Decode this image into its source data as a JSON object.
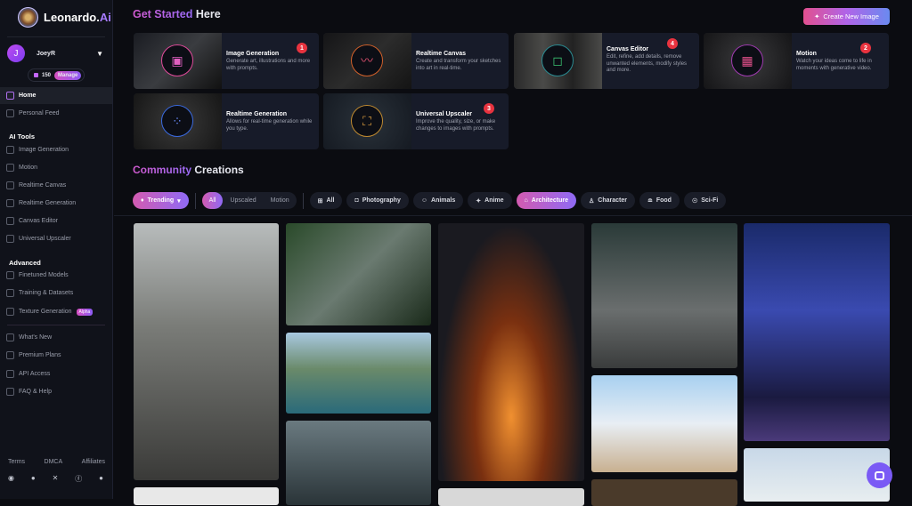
{
  "sidebar": {
    "logo": "Leonardo.",
    "logo_ai": "Ai",
    "user": "JoeyR",
    "avatar_initial": "J",
    "tokens": "150",
    "manage": "Manage",
    "home": "Home",
    "personal_feed": "Personal Feed",
    "ai_tools": "AI Tools",
    "tools": [
      "Image Generation",
      "Motion",
      "Realtime Canvas",
      "Realtime Generation",
      "Canvas Editor",
      "Universal Upscaler"
    ],
    "advanced": "Advanced",
    "advanced_items": [
      "Finetuned Models",
      "Training & Datasets",
      "Texture Generation"
    ],
    "alpha": "Alpha",
    "misc": [
      "What's New",
      "Premium Plans",
      "API Access",
      "FAQ & Help"
    ],
    "footer": [
      "Terms",
      "DMCA",
      "Affiliates"
    ],
    "social": [
      "discord-icon",
      "reddit-icon",
      "x-icon",
      "facebook-icon",
      "apple-icon"
    ]
  },
  "header": {
    "title_a": "Get Started",
    "title_b": "Here",
    "create": "Create New Image"
  },
  "cards": [
    {
      "title": "Image Generation",
      "desc": "Generate art, illustrations and more with prompts.",
      "badge": "1"
    },
    {
      "title": "Realtime Canvas",
      "desc": "Create and transform your sketches into art in real-time.",
      "badge": ""
    },
    {
      "title": "Canvas Editor",
      "desc": "Edit, refine, add details, remove unwanted elements, modify styles and more.",
      "badge": "4"
    },
    {
      "title": "Motion",
      "desc": "Watch your ideas come to life in moments with generative video.",
      "badge": "2"
    },
    {
      "title": "Realtime Generation",
      "desc": "Allows for real-time generation while you type.",
      "badge": ""
    },
    {
      "title": "Universal Upscaler",
      "desc": "Improve the quality, size, or make changes to images with prompts.",
      "badge": "3"
    }
  ],
  "community": {
    "title_a": "Community",
    "title_b": "Creations",
    "trending": "Trending",
    "seg": [
      "All",
      "Upscaled",
      "Motion"
    ],
    "categories": [
      "All",
      "Photography",
      "Animals",
      "Anime",
      "Architecture",
      "Character",
      "Food",
      "Sci-Fi"
    ],
    "selected_category": "Architecture"
  }
}
